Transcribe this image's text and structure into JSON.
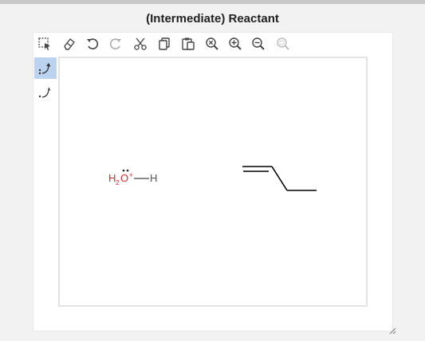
{
  "title": "(Intermediate) Reactant",
  "toolbar": {
    "tools": [
      {
        "name": "select-tool",
        "icon": "lasso-select-icon"
      },
      {
        "name": "erase-tool",
        "icon": "eraser-icon"
      },
      {
        "name": "undo-tool",
        "icon": "undo-icon"
      },
      {
        "name": "redo-tool",
        "icon": "redo-icon"
      },
      {
        "name": "cut-tool",
        "icon": "scissors-icon"
      },
      {
        "name": "copy-tool",
        "icon": "copy-icon"
      },
      {
        "name": "paste-tool",
        "icon": "paste-icon"
      },
      {
        "name": "zoom-reset-tool",
        "icon": "zoom-reset-icon"
      },
      {
        "name": "zoom-in-tool",
        "icon": "zoom-in-icon"
      },
      {
        "name": "zoom-out-tool",
        "icon": "zoom-out-icon"
      },
      {
        "name": "zoom-fit-tool",
        "icon": "zoom-fit-icon"
      }
    ]
  },
  "side_tools": [
    {
      "name": "electron-pair-arrow-tool",
      "icon": "curved-arrow-pair-icon",
      "active": true
    },
    {
      "name": "single-electron-arrow-tool",
      "icon": "curved-arrow-single-icon",
      "active": false
    }
  ],
  "molecules": {
    "hydronium": {
      "h2": "H",
      "sub": "2",
      "o": "O",
      "charge": "+",
      "h": "H",
      "color": "#d42a2a"
    }
  },
  "colors": {
    "accent": "#bcd3f0",
    "atom_red": "#d42a2a",
    "bond": "#000000"
  }
}
